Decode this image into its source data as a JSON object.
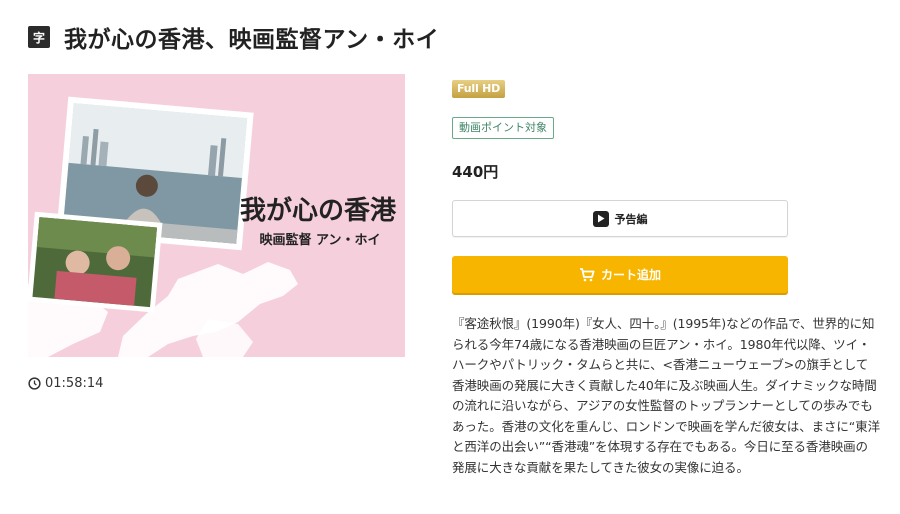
{
  "header": {
    "subtitle_badge": "字",
    "title": "我が心の香港、映画監督アン・ホイ"
  },
  "thumbnail": {
    "title_main": "我が心の香港",
    "title_sub": "映画監督 アン・ホイ"
  },
  "meta": {
    "duration": "01:58:14"
  },
  "purchase": {
    "quality_badge": "Full HD",
    "point_tag": "動画ポイント対象",
    "price": "440円",
    "trailer_label": "予告編",
    "cart_label": "カート追加"
  },
  "description": "『客途秋恨』(1990年)『女人、四十。』(1995年)などの作品で、世界的に知られる今年74歳になる香港映画の巨匠アン・ホイ。1980年代以降、ツイ・ハークやパトリック・タムらと共に、<香港ニューウェーブ>の旗手として香港映画の発展に大きく貢献した40年に及ぶ映画人生。ダイナミックな時間の流れに沿いながら、アジアの女性監督のトップランナーとしての歩みでもあった。香港の文化を重んじ、ロンドンで映画を学んだ彼女は、まさに“東洋と西洋の出会い”“香港魂”を体現する存在でもある。今日に至る香港映画の発展に大きな貢献を果たしてきた彼女の実像に迫る。",
  "colors": {
    "accent_cart": "#f7b500",
    "point_tag": "#3f8565",
    "thumb_bg": "#f6cfdd"
  }
}
